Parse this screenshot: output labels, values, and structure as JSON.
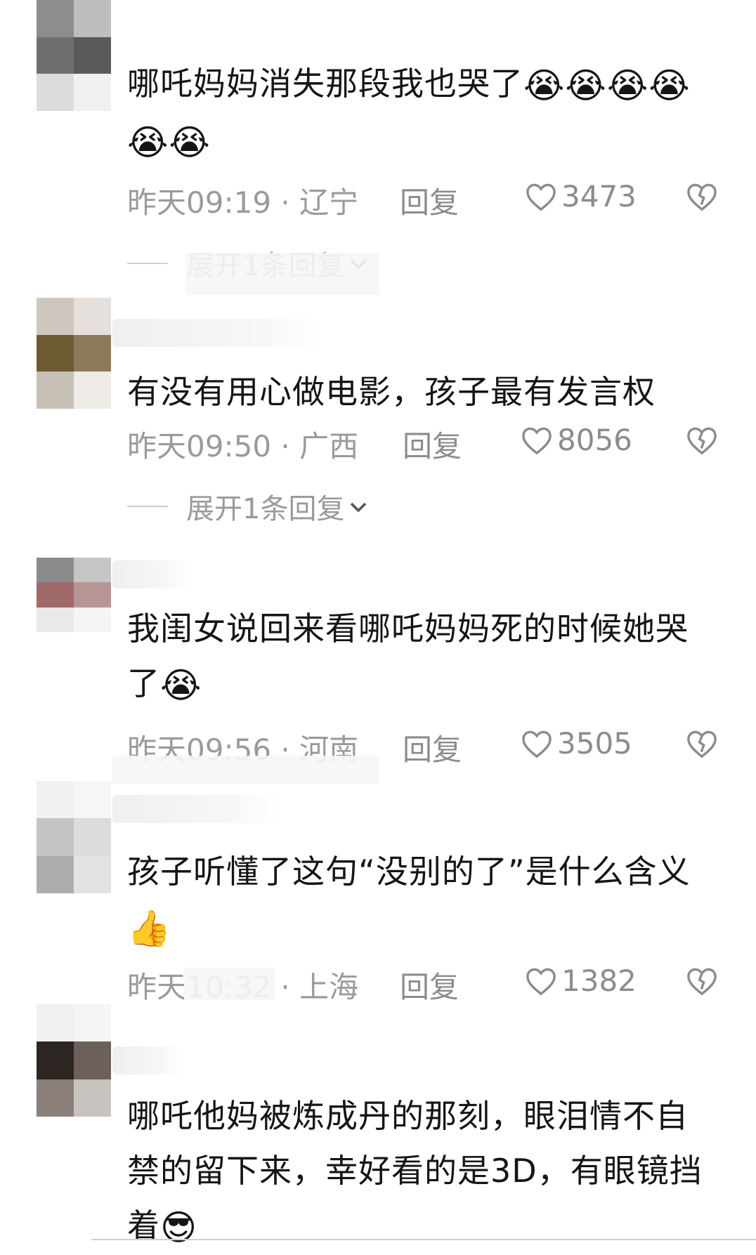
{
  "comments": [
    {
      "text": "哪吒妈妈消失那段我也哭了",
      "emoji": "😭😭😭😭😭😭",
      "time": "昨天09:19 · 辽宁",
      "reply": "回复",
      "likes": "3473",
      "expand": "展开1条回复"
    },
    {
      "text": "有没有用心做电影，孩子最有发言权",
      "emoji": "",
      "time": "昨天09:50 · 广西",
      "reply": "回复",
      "likes": "8056",
      "expand": "展开1条回复"
    },
    {
      "text": "我闺女说回来看哪吒妈妈死的时候她哭了",
      "emoji": "😭",
      "time": "昨天09:56 · 河南",
      "reply": "回复",
      "likes": "3505"
    },
    {
      "text": "孩子听懂了这句“没别的了”是什么含义",
      "emoji": "👍",
      "time": "昨天10:32 · 上海",
      "reply": "回复",
      "likes": "1382"
    },
    {
      "text": "哪吒他妈被炼成丹的那刻，眼泪情不自禁的留下来，幸好看的是3D，有眼镜挡着",
      "emoji": "😎"
    }
  ],
  "icons": {
    "like": "heart-outline-icon",
    "dislike": "broken-heart-icon",
    "expand": "chevron-down-icon"
  },
  "colors": {
    "meta_text": "#9a9a9a",
    "body_text": "#151515"
  }
}
